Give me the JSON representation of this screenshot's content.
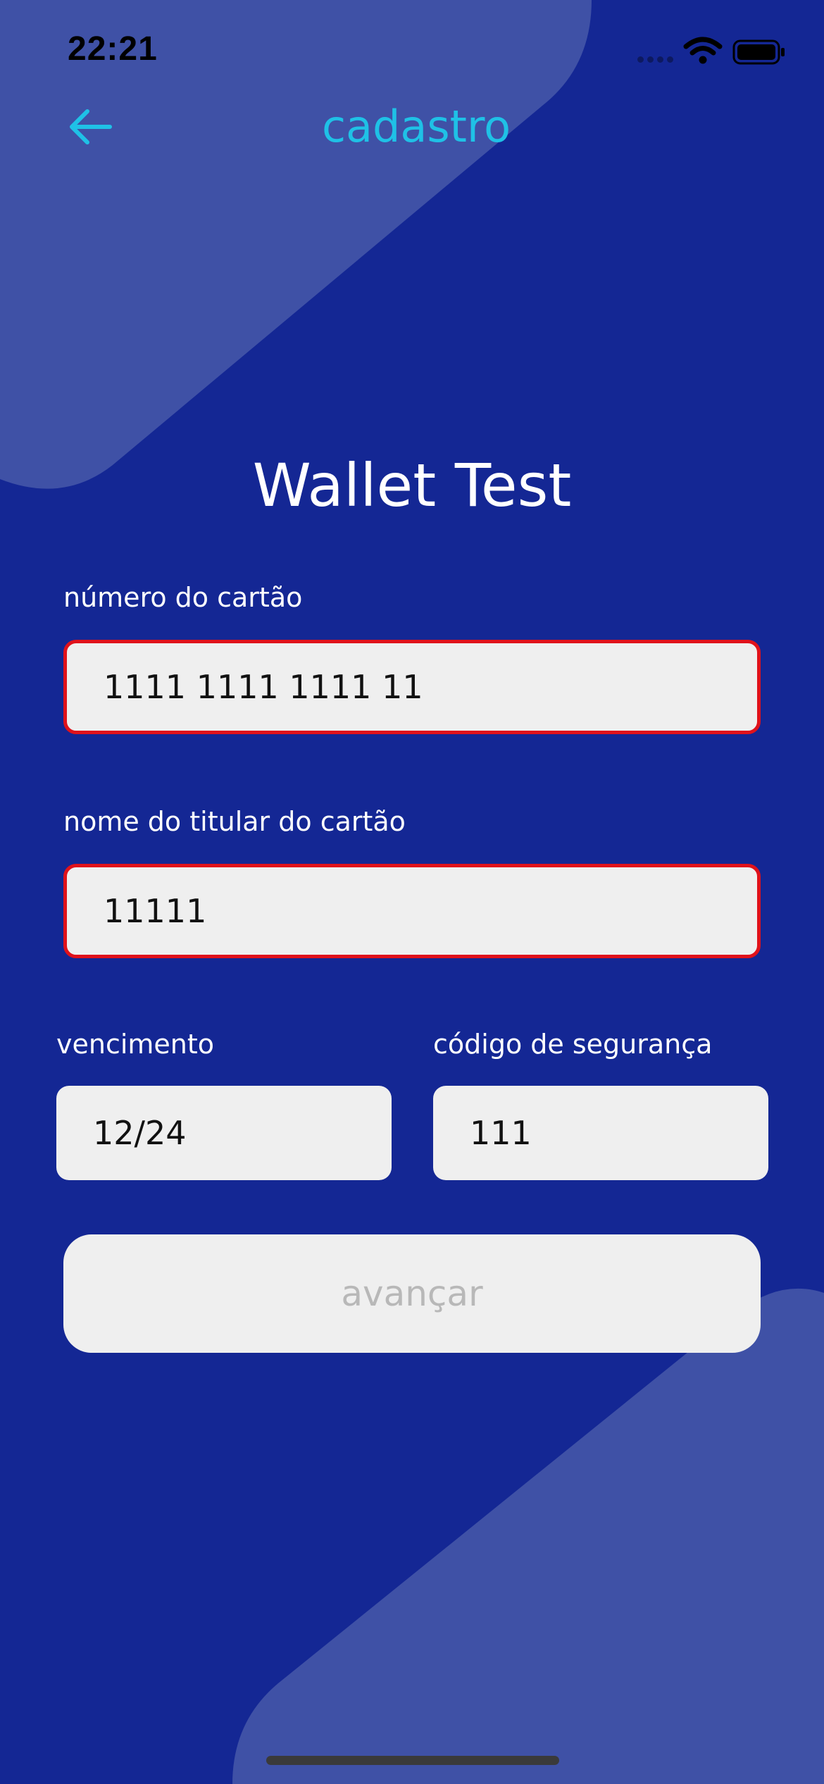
{
  "status_bar": {
    "time": "22:21",
    "icons": [
      "signal-icon",
      "wifi-icon",
      "battery-icon"
    ]
  },
  "nav": {
    "back_icon": "arrow-left-icon",
    "title": "cadastro"
  },
  "app_title": "Wallet Test",
  "form": {
    "card_number": {
      "label": "número do cartão",
      "value": "1111 1111 1111 11",
      "error": true
    },
    "holder_name": {
      "label": "nome do titular do cartão",
      "value": "11111",
      "error": true
    },
    "expiry": {
      "label": "vencimento",
      "value": "12/24",
      "error": false
    },
    "cvv": {
      "label": "código de segurança",
      "value": "111",
      "error": false
    }
  },
  "advance_button": {
    "label": "avançar",
    "disabled": true
  },
  "colors": {
    "background": "#142794",
    "shape": "#3f51a6",
    "accent": "#1fc1e6",
    "field": "#efefef",
    "error_border": "#e0121b",
    "disabled_text": "#b8b8b8"
  }
}
